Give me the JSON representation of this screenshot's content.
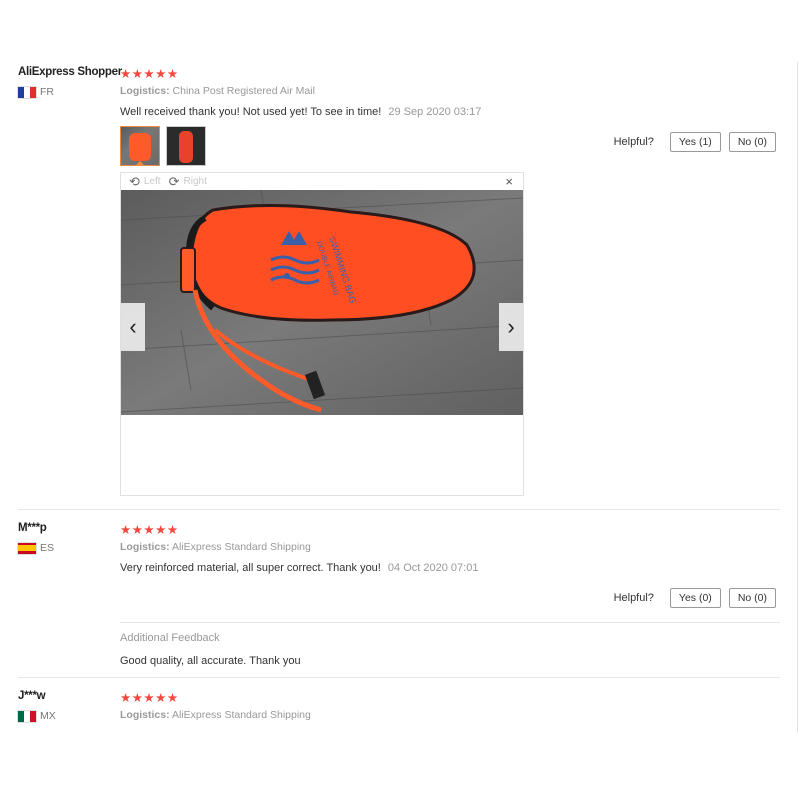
{
  "reviews": [
    {
      "user": "AliExpress Shopper",
      "country": "FR",
      "stars": "★★★★★",
      "logistics_label": "Logistics:",
      "logistics": "China Post Registered Air Mail",
      "comment": "Well received thank you! Not used yet! To see in time!",
      "date": "29 Sep 2020 03:17",
      "helpful_label": "Helpful?",
      "yes_label": "Yes (1)",
      "no_label": "No (0)",
      "viewer": {
        "rotate_left": "Left",
        "rotate_right": "Right",
        "close": "×",
        "prev": "‹",
        "next": "›",
        "product_text_1": "SWIMMING BAG",
        "product_text_2": "DOUBLE AIRBAG"
      }
    },
    {
      "user": "M***p",
      "country": "ES",
      "stars": "★★★★★",
      "logistics_label": "Logistics:",
      "logistics": "AliExpress Standard Shipping",
      "comment": "Very reinforced material, all super correct. Thank you!",
      "date": "04 Oct 2020 07:01",
      "helpful_label": "Helpful?",
      "yes_label": "Yes (0)",
      "no_label": "No (0)",
      "additional_title": "Additional Feedback",
      "additional_text": "Good quality, all accurate. Thank you"
    },
    {
      "user": "J***w",
      "country": "MX",
      "stars": "★★★★★",
      "logistics_label": "Logistics:",
      "logistics": "AliExpress Standard Shipping"
    }
  ],
  "colors": {
    "star": "#f5473c",
    "active_thumb": "#f08a40",
    "bag": "#ff5a2a"
  }
}
